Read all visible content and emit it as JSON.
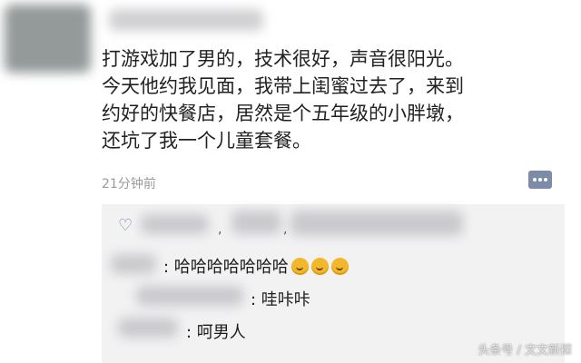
{
  "post": {
    "lines": [
      "打游戏加了男的，技术很好，声音很阳光。",
      "今天他约我见面，我带上闺蜜过去了，来到",
      "约好的快餐店，居然是个五年级的小胖墩，",
      "还坑了我一个儿童套餐。"
    ],
    "timestamp": "21分钟前"
  },
  "interactions": {
    "like_separators": [
      ",",
      ","
    ],
    "comments": [
      {
        "text": ": 哈哈哈哈哈哈哈",
        "emoji": [
          "thinking-face-emoji",
          "thinking-face-emoji",
          "thinking-face-emoji"
        ]
      },
      {
        "text": ": 哇咔咔"
      },
      {
        "text": ": 呵男人"
      }
    ]
  },
  "watermark": "头条号 / 文文新探"
}
